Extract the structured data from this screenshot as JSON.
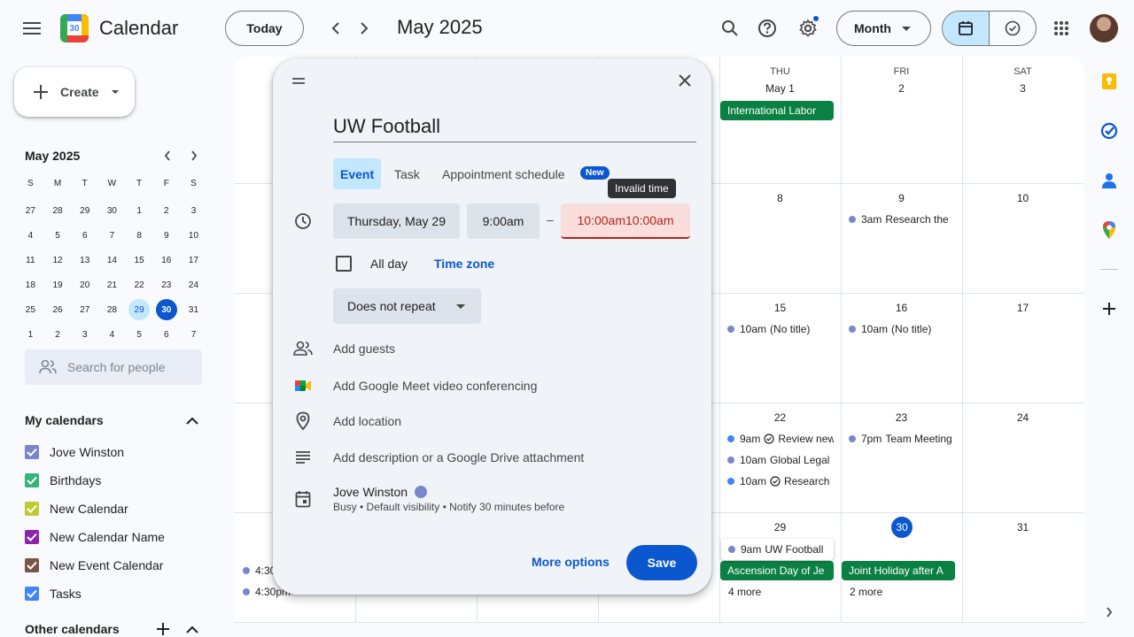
{
  "header": {
    "app_title": "Calendar",
    "logo_number": "30",
    "today_label": "Today",
    "month_title": "May 2025",
    "view_label": "Month",
    "accent": "#0b57d0"
  },
  "sidebar": {
    "create_label": "Create",
    "mini_cal": {
      "title": "May 2025",
      "weekdays": [
        "S",
        "M",
        "T",
        "W",
        "T",
        "F",
        "S"
      ],
      "weeks": [
        [
          "27",
          "28",
          "29",
          "30",
          "1",
          "2",
          "3"
        ],
        [
          "4",
          "5",
          "6",
          "7",
          "8",
          "9",
          "10"
        ],
        [
          "11",
          "12",
          "13",
          "14",
          "15",
          "16",
          "17"
        ],
        [
          "18",
          "19",
          "20",
          "21",
          "22",
          "23",
          "24"
        ],
        [
          "25",
          "26",
          "27",
          "28",
          "29",
          "30",
          "31"
        ],
        [
          "1",
          "2",
          "3",
          "4",
          "5",
          "6",
          "7"
        ]
      ],
      "selected": "29",
      "today": "30"
    },
    "people_search_placeholder": "Search for people",
    "my_calendars_title": "My calendars",
    "calendars": [
      {
        "name": "Jove Winston",
        "color": "#7986cb"
      },
      {
        "name": "Birthdays",
        "color": "#33b679"
      },
      {
        "name": "New Calendar",
        "color": "#c0ca33"
      },
      {
        "name": "New Calendar Name",
        "color": "#8e24aa"
      },
      {
        "name": "New Event Calendar",
        "color": "#795548"
      },
      {
        "name": "Tasks",
        "color": "#4285f4"
      }
    ],
    "other_calendars_title": "Other calendars"
  },
  "grid": {
    "dow": {
      "thu": "THU",
      "fri": "FRI",
      "sat": "SAT"
    },
    "days": {
      "thu1": "May 1",
      "fri1": "2",
      "sat1": "3",
      "thu2": "8",
      "fri2": "9",
      "sat2": "10",
      "thu3": "15",
      "fri3": "16",
      "sat3": "17",
      "thu4": "22",
      "fri4": "23",
      "sat4": "24",
      "thu5": "29",
      "fri5": "30",
      "sat5": "31"
    },
    "events": {
      "intl_labor": "International Labor",
      "research_time": "3am",
      "research_title": "Research the",
      "w3_thu_time": "10am",
      "w3_thu_title": "(No title)",
      "w3_fri_time": "10am",
      "w3_fri_title": "(No title)",
      "w4_thu_1_time": "9am",
      "w4_thu_1_title": "Review new",
      "w4_thu_2_time": "10am",
      "w4_thu_2_title": "Global Legal",
      "w4_thu_3_time": "10am",
      "w4_thu_3_title": "Research",
      "w4_fri_time": "7pm",
      "w4_fri_title": "Team Meeting",
      "w5_thu_hl_time": "9am",
      "w5_thu_hl_title": "UW Football",
      "ascension": "Ascension Day of Je",
      "thu_more": "4 more",
      "joint_holiday": "Joint Holiday after A",
      "fri_more": "2 more",
      "w5_left_1": "4:30",
      "w5_left_2": "4:30pm"
    }
  },
  "dialog": {
    "title_value": "UW Football",
    "tabs": [
      "Event",
      "Task",
      "Appointment schedule"
    ],
    "new_badge": "New",
    "tooltip": "Invalid time",
    "date": "Thursday, May 29",
    "start_time": "9:00am",
    "dash": "–",
    "end_time": "10:00am10:00am",
    "all_day": "All day",
    "time_zone": "Time zone",
    "repeat": "Does not repeat",
    "add_guests": "Add guests",
    "add_meet": "Add Google Meet video conferencing",
    "add_location": "Add location",
    "add_description": "Add description or a Google Drive attachment",
    "owner": "Jove Winston",
    "owner_sub": "Busy • Default visibility • Notify 30 minutes before",
    "more_options": "More options",
    "save": "Save",
    "error_color": "#b3261e"
  }
}
